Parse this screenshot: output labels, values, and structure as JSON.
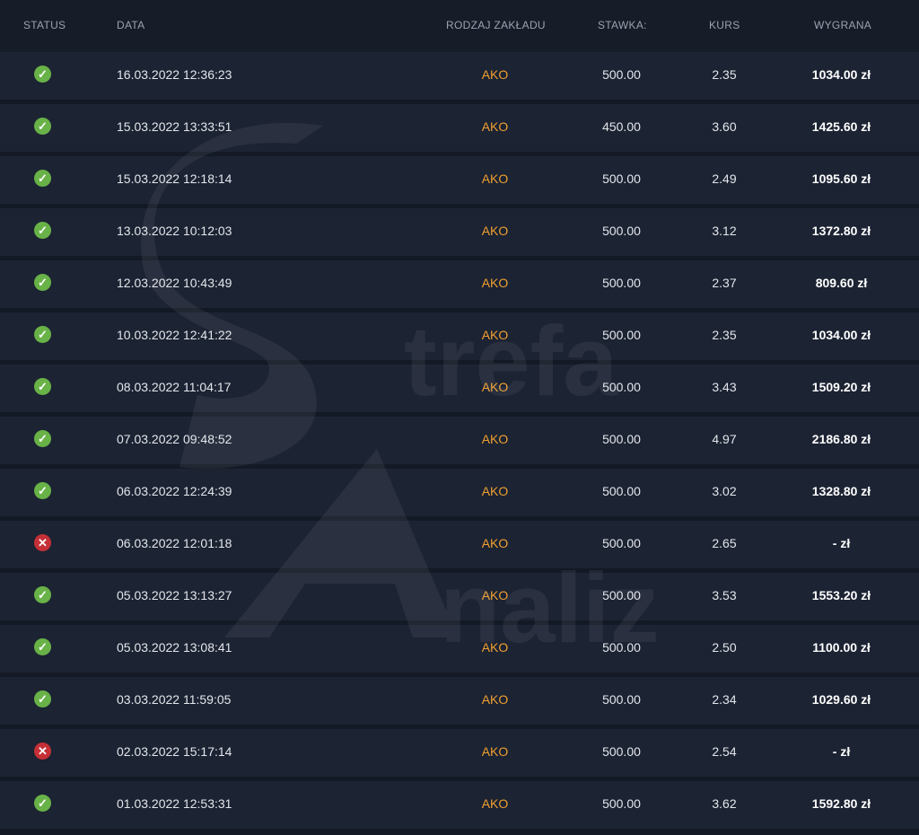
{
  "header": {
    "status": "STATUS",
    "date": "DATA",
    "type": "RODZAJ ZAKŁADU",
    "stake": "STAWKA:",
    "odds": "KURS",
    "win": "WYGRANA"
  },
  "colors": {
    "won": "#68b247",
    "lost": "#c53036",
    "bet_type": "#f0a030"
  },
  "rows": [
    {
      "status": "won",
      "date": "16.03.2022 12:36:23",
      "type": "AKO",
      "stake": "500.00",
      "odds": "2.35",
      "win": "1034.00 zł"
    },
    {
      "status": "won",
      "date": "15.03.2022 13:33:51",
      "type": "AKO",
      "stake": "450.00",
      "odds": "3.60",
      "win": "1425.60 zł"
    },
    {
      "status": "won",
      "date": "15.03.2022 12:18:14",
      "type": "AKO",
      "stake": "500.00",
      "odds": "2.49",
      "win": "1095.60 zł"
    },
    {
      "status": "won",
      "date": "13.03.2022 10:12:03",
      "type": "AKO",
      "stake": "500.00",
      "odds": "3.12",
      "win": "1372.80 zł"
    },
    {
      "status": "won",
      "date": "12.03.2022 10:43:49",
      "type": "AKO",
      "stake": "500.00",
      "odds": "2.37",
      "win": "809.60 zł"
    },
    {
      "status": "won",
      "date": "10.03.2022 12:41:22",
      "type": "AKO",
      "stake": "500.00",
      "odds": "2.35",
      "win": "1034.00 zł"
    },
    {
      "status": "won",
      "date": "08.03.2022 11:04:17",
      "type": "AKO",
      "stake": "500.00",
      "odds": "3.43",
      "win": "1509.20 zł"
    },
    {
      "status": "won",
      "date": "07.03.2022 09:48:52",
      "type": "AKO",
      "stake": "500.00",
      "odds": "4.97",
      "win": "2186.80 zł"
    },
    {
      "status": "won",
      "date": "06.03.2022 12:24:39",
      "type": "AKO",
      "stake": "500.00",
      "odds": "3.02",
      "win": "1328.80 zł"
    },
    {
      "status": "lost",
      "date": "06.03.2022 12:01:18",
      "type": "AKO",
      "stake": "500.00",
      "odds": "2.65",
      "win": "- zł"
    },
    {
      "status": "won",
      "date": "05.03.2022 13:13:27",
      "type": "AKO",
      "stake": "500.00",
      "odds": "3.53",
      "win": "1553.20 zł"
    },
    {
      "status": "won",
      "date": "05.03.2022 13:08:41",
      "type": "AKO",
      "stake": "500.00",
      "odds": "2.50",
      "win": "1100.00 zł"
    },
    {
      "status": "won",
      "date": "03.03.2022 11:59:05",
      "type": "AKO",
      "stake": "500.00",
      "odds": "2.34",
      "win": "1029.60 zł"
    },
    {
      "status": "lost",
      "date": "02.03.2022 15:17:14",
      "type": "AKO",
      "stake": "500.00",
      "odds": "2.54",
      "win": "- zł"
    },
    {
      "status": "won",
      "date": "01.03.2022 12:53:31",
      "type": "AKO",
      "stake": "500.00",
      "odds": "3.62",
      "win": "1592.80 zł"
    }
  ],
  "watermark": {
    "text_1": "trefa",
    "text_2": "naliz"
  }
}
